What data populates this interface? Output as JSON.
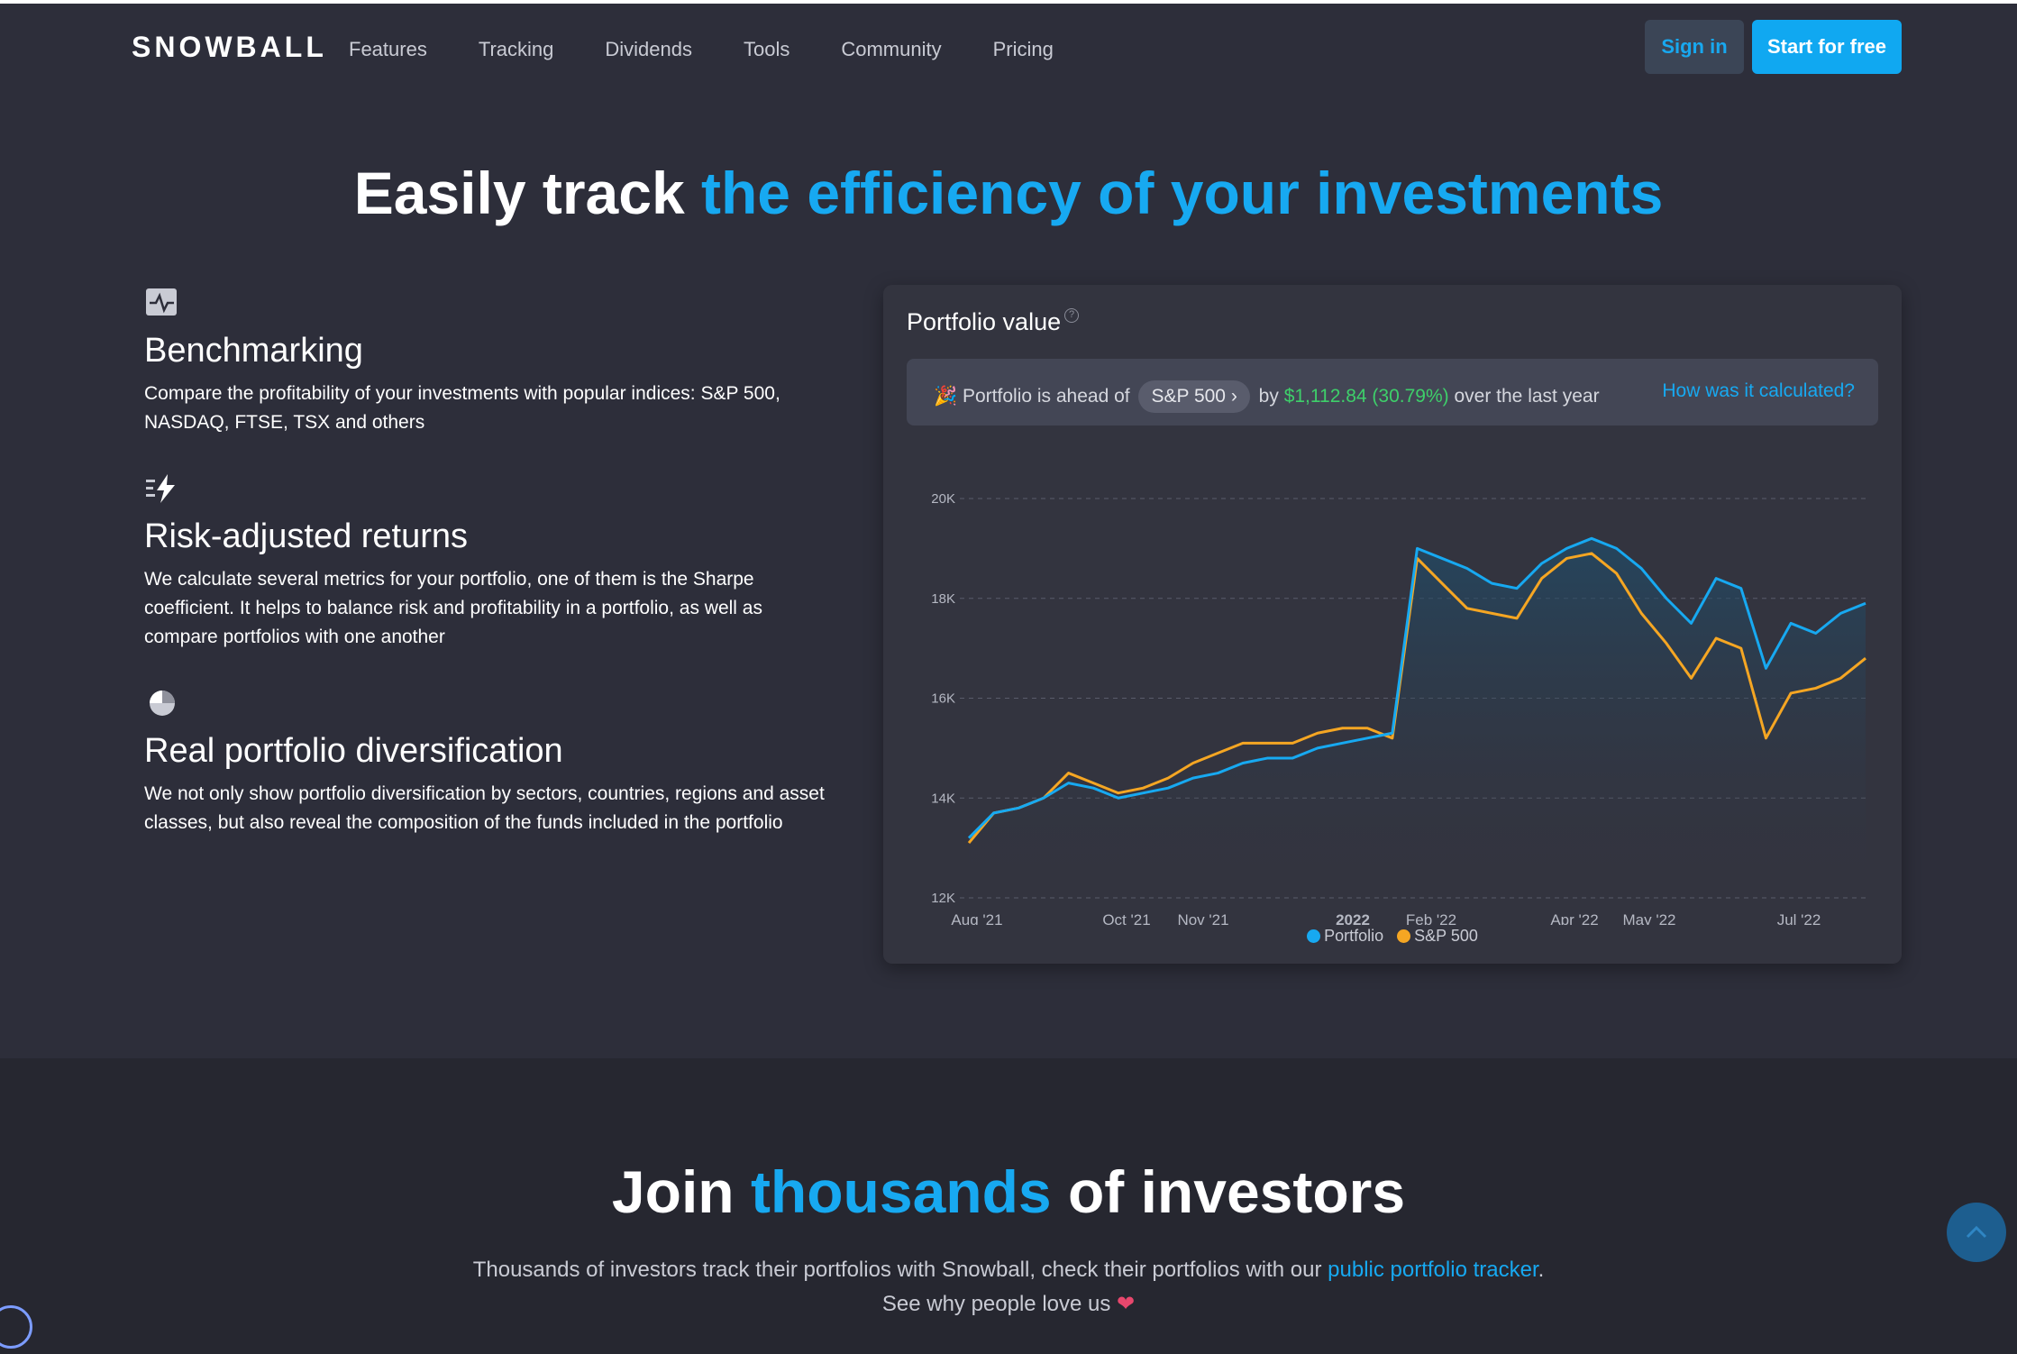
{
  "header": {
    "logo": "SNOWBALL",
    "nav": [
      "Features",
      "Tracking",
      "Dividends",
      "Tools",
      "Community",
      "Pricing"
    ],
    "signin_label": "Sign in",
    "start_label": "Start for free"
  },
  "hero": {
    "title_plain": "Easily track ",
    "title_accent": "the efficiency of your investments"
  },
  "features": [
    {
      "icon": "pulse-icon",
      "title": "Benchmarking",
      "text": "Compare the profitability of your investments with popular indices: S&P 500, NASDAQ, FTSE, TSX and others"
    },
    {
      "icon": "lightning-icon",
      "title": "Risk-adjusted returns",
      "text": "We calculate several metrics for your portfolio, one of them is the Sharpe coefficient. It helps to balance risk and profitability in a portfolio, as well as compare portfolios with one another"
    },
    {
      "icon": "pie-icon",
      "title": "Real portfolio diversification",
      "text": "We not only show portfolio diversification by sectors, countries, regions and asset classes, but also reveal the composition of the funds included in the portfolio"
    }
  ],
  "card": {
    "title": "Portfolio value",
    "help": "?",
    "banner": {
      "emoji": "🎉",
      "prefix": "Portfolio is ahead of",
      "benchmark": "S&P 500",
      "chevron": "›",
      "by": "by",
      "amount": "$1,112.84",
      "percent": "(30.79%)",
      "suffix": "over the last year",
      "link": "How was it calculated?"
    }
  },
  "chart_data": {
    "type": "line",
    "y_ticks": [
      "20K",
      "18K",
      "16K",
      "14K",
      "12K"
    ],
    "ylim": [
      12000,
      20000
    ],
    "x_ticks": [
      "Aug '21",
      "Oct '21",
      "Nov '21",
      "2022",
      "Feb '22",
      "Apr '22",
      "May '22",
      "Jul '22"
    ],
    "series": [
      {
        "name": "Portfolio",
        "color": "#17a9f1",
        "values": [
          13200,
          13700,
          13800,
          14000,
          14300,
          14200,
          14000,
          14100,
          14200,
          14400,
          14500,
          14700,
          14800,
          14800,
          15000,
          15100,
          15200,
          15300,
          19000,
          18800,
          18600,
          18300,
          18200,
          18700,
          19000,
          19200,
          19000,
          18600,
          18000,
          17500,
          18400,
          18200,
          16600,
          17500,
          17300,
          17700,
          17900
        ]
      },
      {
        "name": "S&P 500",
        "color": "#f5a623",
        "values": [
          13100,
          13700,
          13800,
          14000,
          14500,
          14300,
          14100,
          14200,
          14400,
          14700,
          14900,
          15100,
          15100,
          15100,
          15300,
          15400,
          15400,
          15200,
          18800,
          18300,
          17800,
          17700,
          17600,
          18400,
          18800,
          18900,
          18500,
          17700,
          17100,
          16400,
          17200,
          17000,
          15200,
          16100,
          16200,
          16400,
          16800
        ]
      }
    ]
  },
  "legend": [
    {
      "name": "Portfolio",
      "color": "#17a9f1"
    },
    {
      "name": "S&P 500",
      "color": "#f5a623"
    }
  ],
  "join": {
    "title_a": "Join ",
    "title_accent": "thousands",
    "title_b": " of investors",
    "sub_a": "Thousands of investors track their portfolios with Snowball, check their portfolios with our ",
    "sub_link": "public portfolio tracker",
    "sub_b": ".",
    "sub_line2": "See why people love us ",
    "heart": "❤"
  }
}
